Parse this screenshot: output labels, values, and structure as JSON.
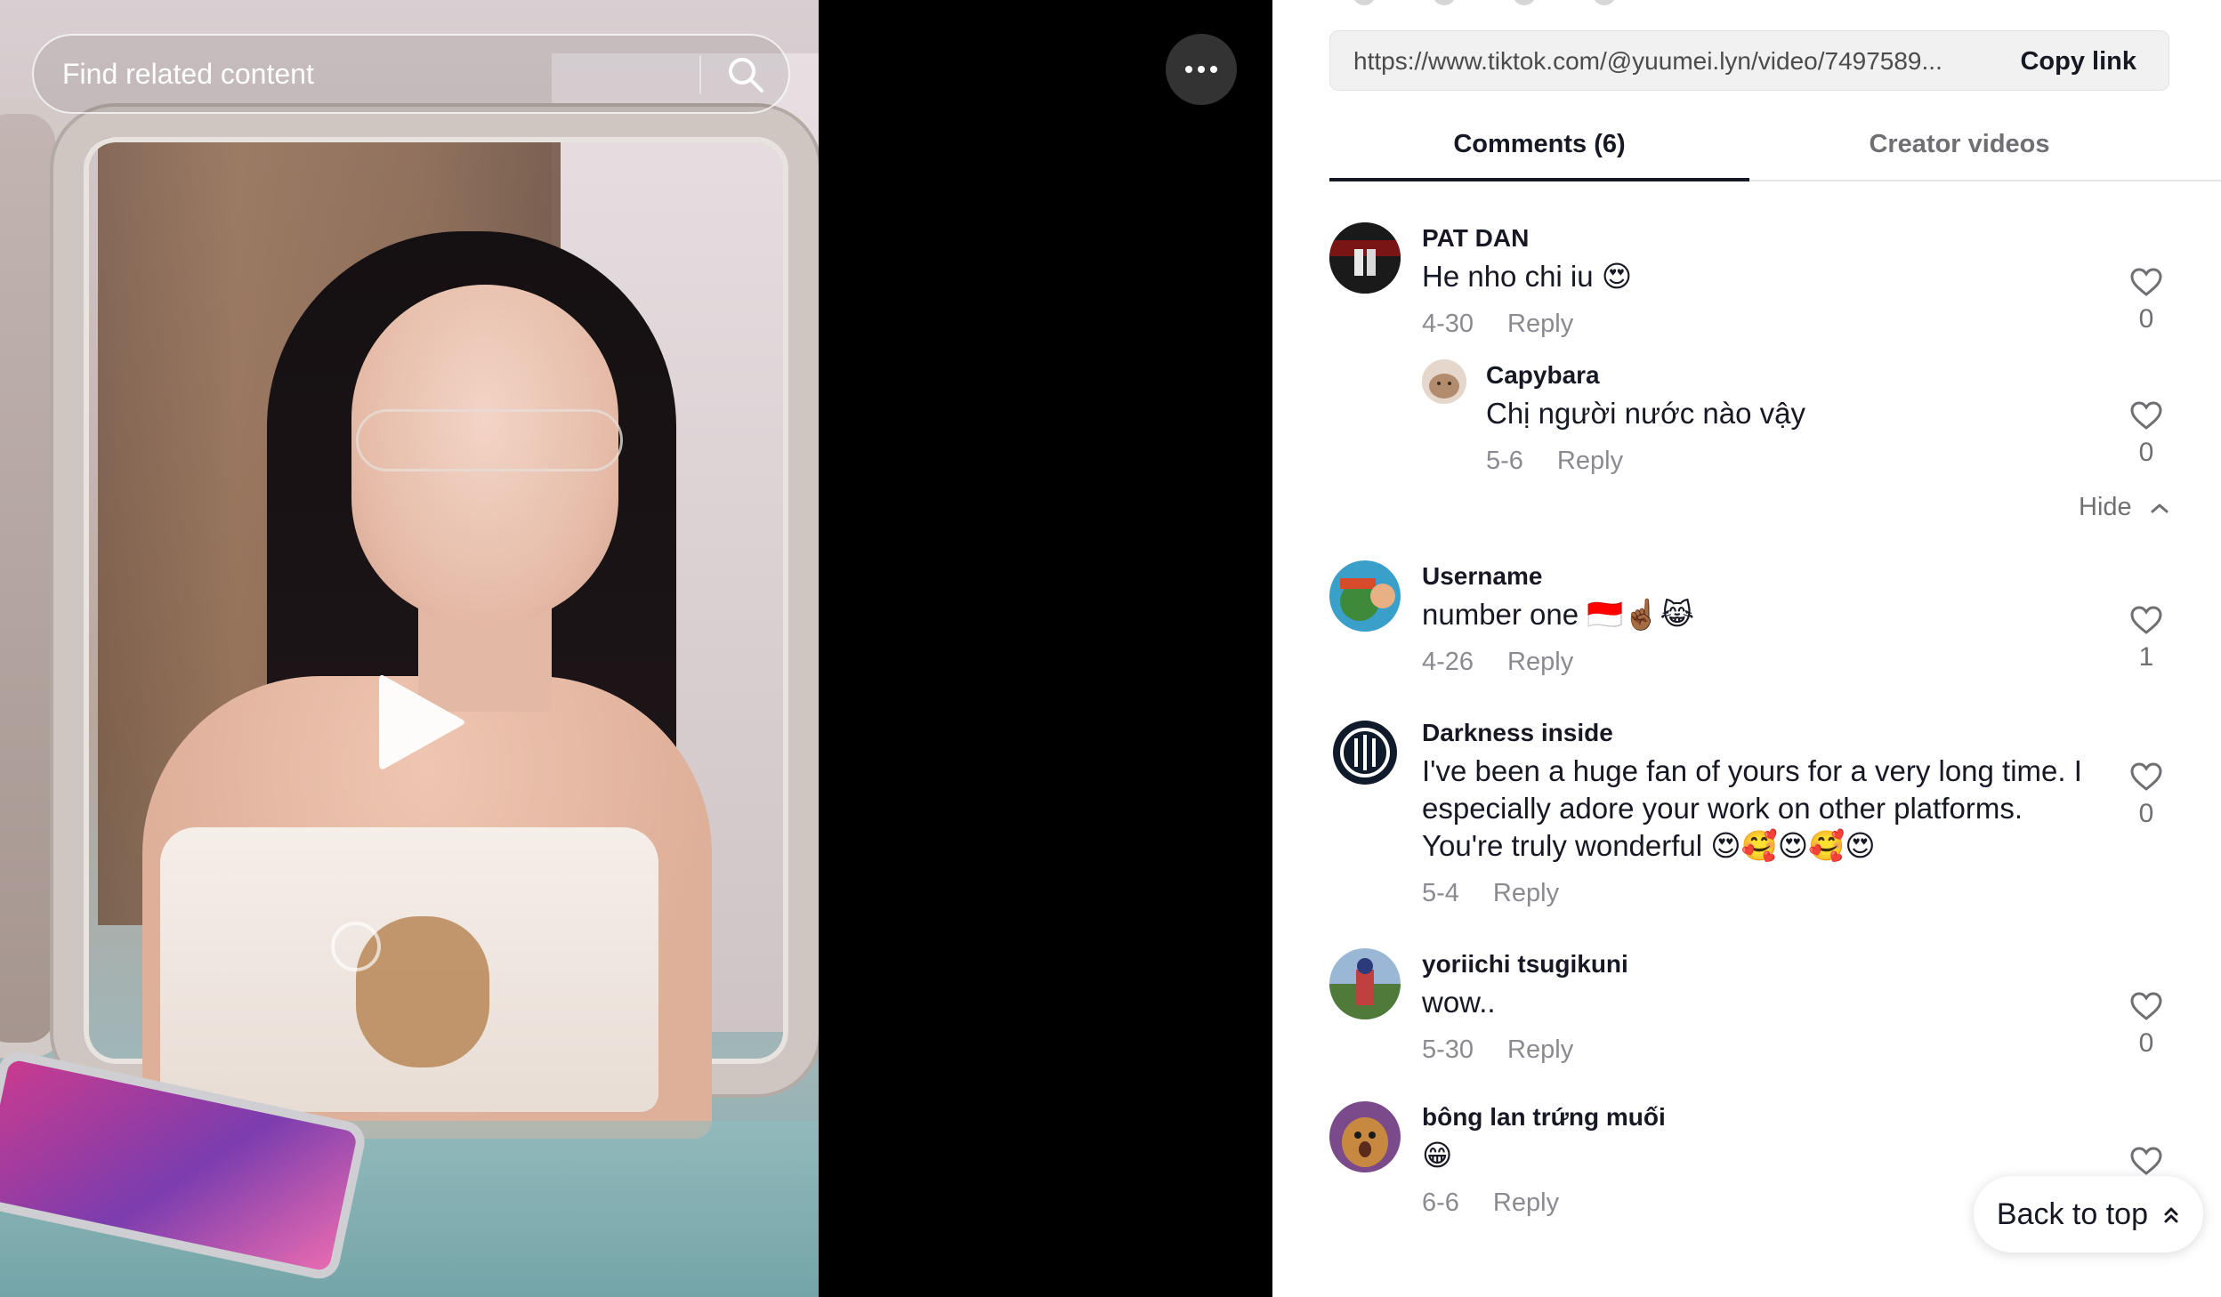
{
  "video": {
    "search_placeholder": "Find related content"
  },
  "share": {
    "url": "https://www.tiktok.com/@yuumei.lyn/video/7497589...",
    "copy_label": "Copy link"
  },
  "tabs": [
    {
      "label": "Comments (6)",
      "active": true
    },
    {
      "label": "Creator videos",
      "active": false
    }
  ],
  "comments": [
    {
      "user": "PAT DAN",
      "text": "He nho chi iu 😍",
      "date": "4-30",
      "reply": "Reply",
      "likes": "0"
    },
    {
      "user": "Capybara",
      "text": "Chị người nước nào vậy",
      "date": "5-6",
      "reply": "Reply",
      "likes": "0",
      "is_reply": true
    },
    {
      "user": "Username",
      "text": "number one 🇮🇩☝🏾😹",
      "date": "4-26",
      "reply": "Reply",
      "likes": "1"
    },
    {
      "user": "Darkness inside",
      "text": "I've been a huge fan of yours for a very long time. I especially adore your work on other platforms. You're truly wonderful 😍🥰😍🥰😍",
      "date": "5-4",
      "reply": "Reply",
      "likes": "0"
    },
    {
      "user": "yoriichi tsugikuni",
      "text": "wow..",
      "date": "5-30",
      "reply": "Reply",
      "likes": "0"
    },
    {
      "user": "bông lan trứng muối",
      "text": "😁",
      "date": "6-6",
      "reply": "Reply",
      "likes": ""
    }
  ],
  "hide_label": "Hide",
  "back_to_top_label": "Back to top",
  "colors": {
    "text_primary": "#161823",
    "text_secondary": "#8a8b91",
    "panel_bg": "#ffffff",
    "video_bg": "#000000"
  }
}
